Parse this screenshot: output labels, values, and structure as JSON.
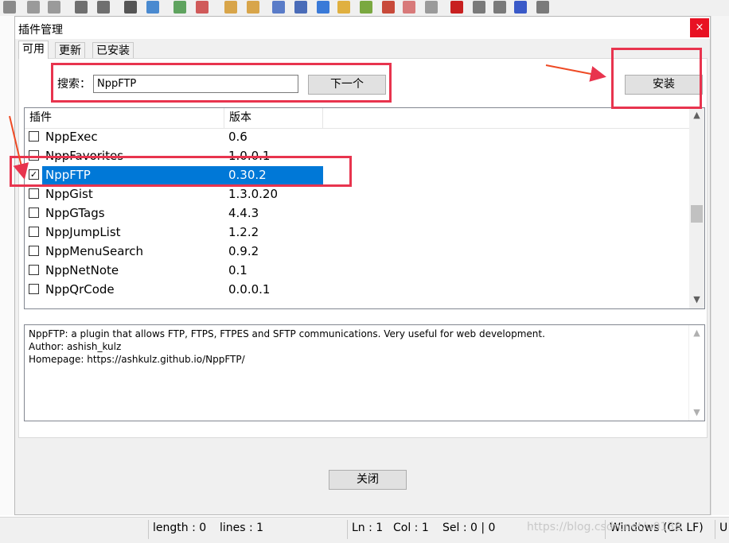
{
  "dialog": {
    "title": "插件管理",
    "close_symbol": "×",
    "tabs": [
      {
        "label": "可用",
        "active": true
      },
      {
        "label": "更新",
        "active": false
      },
      {
        "label": "已安装",
        "active": false
      }
    ],
    "search": {
      "label": "搜索：",
      "value": "NppFTP"
    },
    "next_button": "下一个",
    "install_button": "安装",
    "close_button": "关闭",
    "columns": {
      "plugin": "插件",
      "version": "版本"
    },
    "plugins": [
      {
        "name": "NppExec",
        "version": "0.6",
        "checked": false,
        "selected": false
      },
      {
        "name": "NppFavorites",
        "version": "1.0.0.1",
        "checked": false,
        "selected": false
      },
      {
        "name": "NppFTP",
        "version": "0.30.2",
        "checked": true,
        "selected": true
      },
      {
        "name": "NppGist",
        "version": "1.3.0.20",
        "checked": false,
        "selected": false
      },
      {
        "name": "NppGTags",
        "version": "4.4.3",
        "checked": false,
        "selected": false
      },
      {
        "name": "NppJumpList",
        "version": "1.2.2",
        "checked": false,
        "selected": false
      },
      {
        "name": "NppMenuSearch",
        "version": "0.9.2",
        "checked": false,
        "selected": false
      },
      {
        "name": "NppNetNote",
        "version": "0.1",
        "checked": false,
        "selected": false
      },
      {
        "name": "NppQrCode",
        "version": "0.0.0.1",
        "checked": false,
        "selected": false
      }
    ],
    "description": {
      "line1": "NppFTP: a plugin that allows FTP, FTPS, FTPES and SFTP communications. Very useful for web development.",
      "line2": "Author: ashish_kulz",
      "line3": "Homepage: https://ashkulz.github.io/NppFTP/"
    }
  },
  "statusbar": {
    "length": "length : 0",
    "lines": "lines : 1",
    "ln": "Ln : 1",
    "col": "Col : 1",
    "sel": "Sel : 0 | 0",
    "eol": "Windows (CR LF)",
    "enc": "U"
  },
  "watermark": "https://blog.csdn.net/u0138",
  "colors": {
    "selection": "#0078d7",
    "annotation": "#e8344e",
    "close_button": "#e81123"
  }
}
